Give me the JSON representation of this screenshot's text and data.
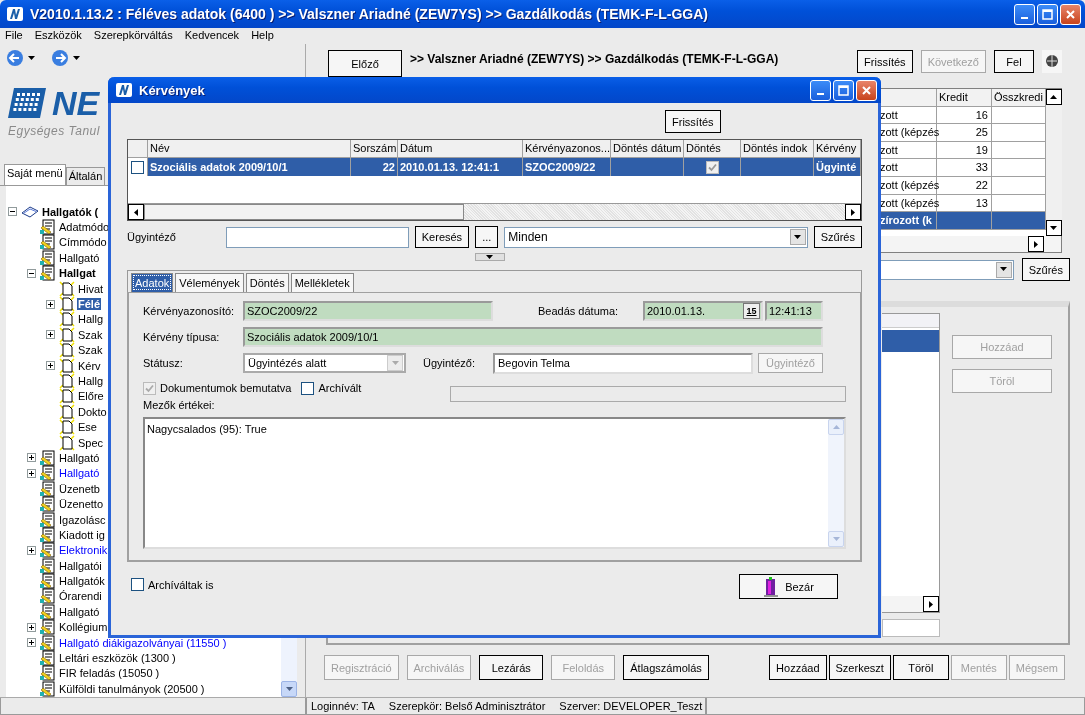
{
  "window": {
    "title": "V2010.1.13.2 : Féléves adatok (6400  )  >> Valszner Ariadné (ZEW7YS) >> Gazdálkodás (TEMK-F-L-GGA)"
  },
  "menu": [
    "File",
    "Eszközök",
    "Szerepkörváltás",
    "Kedvencek",
    "Help"
  ],
  "sidebar": {
    "logo": "NE",
    "logo_subtitle": "Egységes Tanul",
    "tabs": [
      {
        "label": "Saját menü",
        "selected": true
      },
      {
        "label": "Általán",
        "selected": false
      }
    ],
    "tree": [
      {
        "label": "Hallgatók (",
        "kind": "book",
        "bold": true,
        "expanded": true,
        "selected": false,
        "children": [
          {
            "label": "Adatmódo",
            "kind": "notepad",
            "selected": false
          },
          {
            "label": "Címmódo",
            "kind": "notepad",
            "selected": false
          },
          {
            "label": "Hallgató",
            "kind": "notepad",
            "selected": false
          },
          {
            "label": "Hallgat",
            "kind": "notepad",
            "bold": true,
            "expanded": true,
            "selected": false,
            "children": [
              {
                "label": "Hivat",
                "kind": "page",
                "selected": false
              },
              {
                "label": "Félé",
                "kind": "page",
                "bold": true,
                "expanded": false,
                "selected": true
              },
              {
                "label": "Hallg",
                "kind": "page",
                "selected": false
              },
              {
                "label": "Szak",
                "kind": "page",
                "expanded": false,
                "selected": false
              },
              {
                "label": "Szak",
                "kind": "page",
                "selected": false
              },
              {
                "label": "Kérv",
                "kind": "page",
                "expanded": false,
                "selected": false
              },
              {
                "label": "Hallg",
                "kind": "page",
                "selected": false
              },
              {
                "label": "Előre",
                "kind": "page",
                "selected": false
              },
              {
                "label": "Dokto",
                "kind": "page",
                "selected": false
              },
              {
                "label": "Ese",
                "kind": "page",
                "selected": false
              },
              {
                "label": "Spec",
                "kind": "page",
                "selected": false
              }
            ]
          },
          {
            "label": "Hallgató",
            "kind": "notepad",
            "expanded": false,
            "selected": false
          },
          {
            "label": "Hallgató",
            "kind": "notepad",
            "expanded": false,
            "selected": false,
            "color": "#0000ff"
          },
          {
            "label": "Üzenetb",
            "kind": "notepad",
            "selected": false
          },
          {
            "label": "Üzenetto",
            "kind": "notepad",
            "selected": false
          },
          {
            "label": "Igazolásc",
            "kind": "notepad",
            "selected": false
          },
          {
            "label": "Kiadott ig",
            "kind": "notepad",
            "selected": false
          },
          {
            "label": "Elektronik",
            "kind": "notepad",
            "expanded": false,
            "selected": false,
            "color": "#0000ff"
          },
          {
            "label": "Hallgatói",
            "kind": "notepad",
            "selected": false
          },
          {
            "label": "Hallgatók",
            "kind": "notepad",
            "selected": false
          },
          {
            "label": "Órarendi",
            "kind": "notepad",
            "selected": false
          },
          {
            "label": "Hallgató",
            "kind": "notepad",
            "selected": false
          },
          {
            "label": "Kollégium",
            "kind": "notepad",
            "expanded": false,
            "selected": false
          },
          {
            "label": "Hallgató diákigazolványai (11550  )",
            "kind": "notepad",
            "expanded": false,
            "selected": false,
            "color": "#0000ff"
          },
          {
            "label": "Leltári eszközök (1300  )",
            "kind": "notepad",
            "selected": false
          },
          {
            "label": "FIR feladás (15050  )",
            "kind": "notepad",
            "selected": false
          },
          {
            "label": "Külföldi tanulmányok (20500  )",
            "kind": "notepad",
            "selected": false
          }
        ]
      }
    ]
  },
  "record": {
    "prev_button": "Előző",
    "breadcrumb": ">> Valszner Ariadné (ZEW7YS) >> Gazdálkodás (TEMK-F-L-GGA)",
    "buttons": [
      {
        "label": "Frissítés",
        "disabled": false
      },
      {
        "label": "Következő",
        "disabled": true
      },
      {
        "label": "Fel",
        "disabled": false
      }
    ]
  },
  "grid": {
    "columns": [
      "Kredit",
      "Összkredi"
    ],
    "rows": [
      {
        "column_1": "zott",
        "kredit": "16",
        "selected": false
      },
      {
        "column_1": "zott (képzés",
        "kredit": "25",
        "selected": false
      },
      {
        "column_1": "zott",
        "kredit": "19",
        "selected": false
      },
      {
        "column_1": "zott",
        "kredit": "33",
        "selected": false
      },
      {
        "column_1": "zott (képzés",
        "kredit": "22",
        "selected": false
      },
      {
        "column_1": "zott (képzés",
        "kredit": "13",
        "selected": false
      },
      {
        "column_1": "zírozott (k",
        "selected": true
      }
    ]
  },
  "filter_button": "Szűrés",
  "detail": {
    "list_rows": [
      {
        "selected": true
      }
    ],
    "buttons": [
      {
        "label": "Hozzáad",
        "disabled": true
      },
      {
        "label": "Töröl",
        "disabled": true
      }
    ]
  },
  "actions_left": [
    {
      "label": "Regisztráció",
      "disabled": true
    },
    {
      "label": "Archiválás",
      "disabled": true
    },
    {
      "label": "Lezárás",
      "disabled": false
    },
    {
      "label": "Feloldás",
      "disabled": true
    },
    {
      "label": "Átlagszámolás",
      "disabled": false
    }
  ],
  "actions_right": [
    {
      "label": "Hozzáad",
      "disabled": false
    },
    {
      "label": "Szerkeszt",
      "disabled": false
    },
    {
      "label": "Töröl",
      "disabled": false
    },
    {
      "label": "Mentés",
      "disabled": true
    },
    {
      "label": "Mégsem",
      "disabled": true
    }
  ],
  "status_bar": [
    "Loginnév: TA",
    "Szerepkör: Belső Adminisztrátor",
    "Szerver: DEVELOPER_Teszt"
  ],
  "dialog": {
    "title": "Kérvények",
    "refresh_button": "Frissítés",
    "table": {
      "columns": [
        "Név",
        "Sorszám",
        "Dátum",
        "Kérvényazonos...",
        "Döntés dátum",
        "Döntés",
        "Döntés indok",
        "Kérvény"
      ],
      "rows": [
        {
          "selected": true,
          "checked": false,
          "name": "Szociális adatok 2009/10/1",
          "number": "22",
          "date": "2010.01.13. 12:41:1",
          "request_id": "SZOC2009/22",
          "decision": true,
          "status": "Ügyinté"
        }
      ]
    },
    "filter": {
      "label": "Ügyintéző",
      "search_button": "Keresés",
      "more_button": "...",
      "select_value": "Minden",
      "filter_button": "Szűrés"
    },
    "tabs": [
      {
        "label": "Adatok",
        "selected": true
      },
      {
        "label": "Vélemények",
        "selected": false
      },
      {
        "label": "Döntés",
        "selected": false
      },
      {
        "label": "Mellékletek",
        "selected": false
      }
    ],
    "form": {
      "id_label": "Kérvényazonosító:",
      "id_value": "SZOC2009/22",
      "date_label": "Beadás dátuma:",
      "date_value": "2010.01.13.",
      "calendar_day": "15",
      "time_value": "12:41:13",
      "type_label": "Kérvény típusa:",
      "type_value": "Szociális adatok 2009/10/1",
      "status_label": "Státusz:",
      "status_value": "Ügyintézés alatt",
      "officer_label": "Ügyintéző:",
      "officer_value": "Begovin Telma",
      "officer_button": "Ügyintéző",
      "documents": {
        "label": "Dokumentumok bemutatva",
        "checked": true
      },
      "archived": {
        "label": "Archívált",
        "checked": false
      },
      "fields_label": "Mezők értékei:",
      "fields_value": "Nagycsalados (95): True"
    },
    "archived_filter": {
      "label": "Archíváltak is",
      "checked": false
    },
    "close_button": "Bezár"
  }
}
